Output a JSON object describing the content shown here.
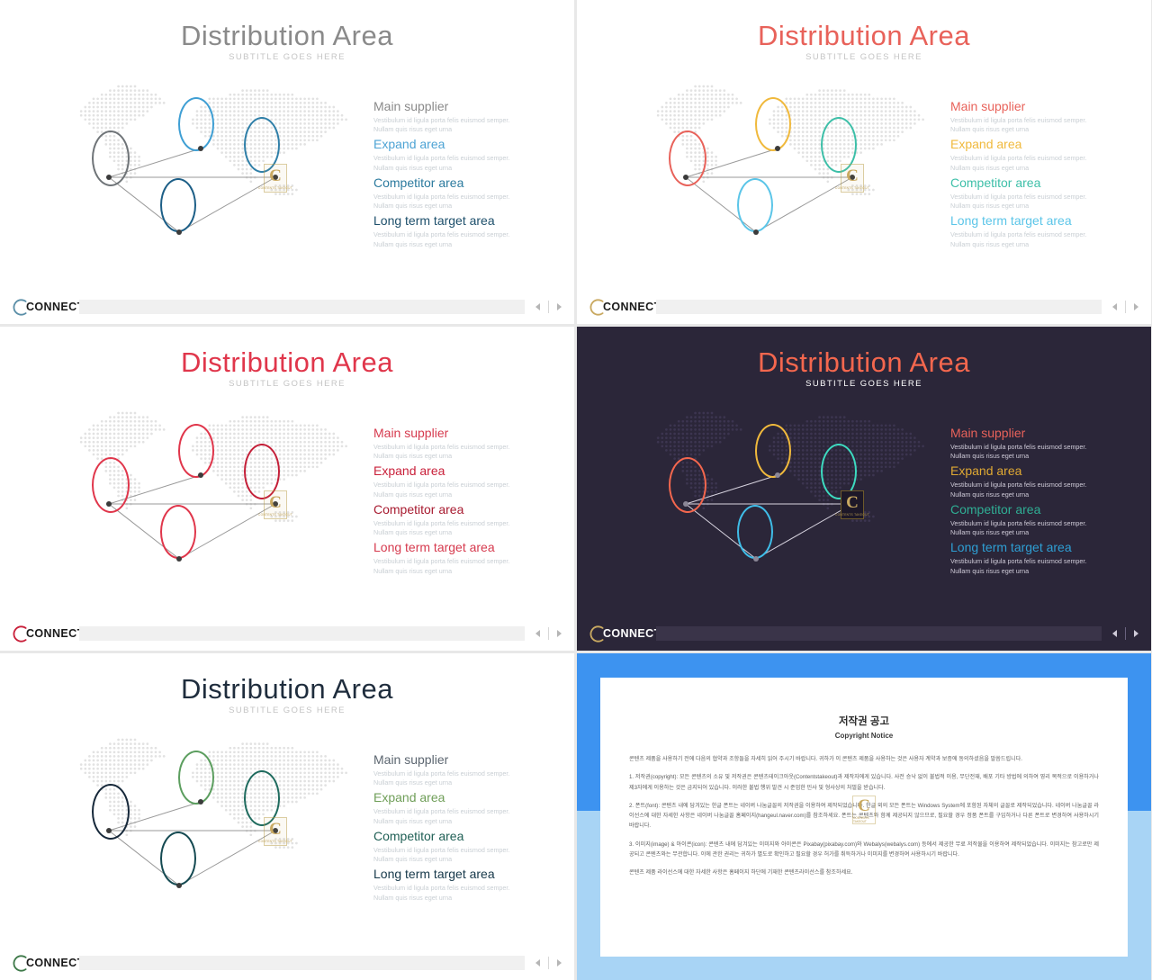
{
  "palettes": {
    "blue": {
      "title": "#8a8a8a",
      "ellipses": [
        "#6f7478",
        "#3f9fd4",
        "#2f7fa8",
        "#1d5f87"
      ],
      "legend": [
        "#8a8a8a",
        "#4da3d4",
        "#2b7a9e",
        "#1d4f6b"
      ]
    },
    "multi": {
      "title": "#e8625a",
      "ellipses": [
        "#e8625a",
        "#f0b93c",
        "#3dbfa8",
        "#5bc5e8"
      ],
      "legend": [
        "#e8625a",
        "#f0b93c",
        "#3dbfa8",
        "#5bc5e8"
      ]
    },
    "red": {
      "title": "#e0364b",
      "ellipses": [
        "#e0364b",
        "#e0364b",
        "#c41f38",
        "#e0364b"
      ],
      "legend": [
        "#d63a4e",
        "#c9203a",
        "#a81b30",
        "#d63a4e"
      ]
    },
    "dark": {
      "title": "#f4674e",
      "ellipses": [
        "#f4674e",
        "#f0b93c",
        "#3ddbc0",
        "#3fbde8"
      ],
      "legend": [
        "#e8625a",
        "#e0a933",
        "#2fae94",
        "#2e9fd4"
      ]
    },
    "green": {
      "title": "#1f2d3d",
      "ellipses": [
        "#16283a",
        "#5c9e5f",
        "#1f6b5e",
        "#154a52"
      ],
      "legend": [
        "#5c6670",
        "#6f9e58",
        "#1f5f55",
        "#16384a"
      ]
    }
  },
  "slides": [
    {
      "name": "distribution-area-blue",
      "title": "Distribution Area",
      "subtitle": "SUBTITLE GOES HERE",
      "palette": "blue",
      "theme": "light"
    },
    {
      "name": "distribution-area-multicolor",
      "title": "Distribution Area",
      "subtitle": "SUBTITLE GOES HERE",
      "palette": "multi",
      "theme": "light"
    },
    {
      "name": "distribution-area-red",
      "title": "Distribution Area",
      "subtitle": "SUBTITLE GOES HERE",
      "palette": "red",
      "theme": "light"
    },
    {
      "name": "distribution-area-dark",
      "title": "Distribution Area",
      "subtitle": "SUBTITLE GOES HERE",
      "palette": "dark",
      "theme": "dark"
    },
    {
      "name": "distribution-area-green",
      "title": "Distribution Area",
      "subtitle": "SUBTITLE GOES HERE",
      "palette": "green",
      "theme": "light"
    }
  ],
  "legend": {
    "items": [
      {
        "heading": "Main supplier",
        "body": "Vestibulum id ligula porta felis euismod semper. Nullam quis risus eget urna"
      },
      {
        "heading": "Expand area",
        "body": "Vestibulum id ligula porta felis euismod semper. Nullam quis risus eget urna"
      },
      {
        "heading": "Competitor area",
        "body": "Vestibulum id ligula porta felis euismod semper. Nullam quis risus eget urna"
      },
      {
        "heading": "Long term target area",
        "body": "Vestibulum id ligula porta felis euismod semper. Nullam quis risus eget urna"
      }
    ]
  },
  "footer": {
    "logo_text": "CONNECT",
    "logo_icon": "c-arc-icon",
    "prev_icon": "triangle-left-icon",
    "next_icon": "triangle-right-icon"
  },
  "badge": {
    "glyph": "C",
    "caption": "CONTENTS TAKEOUT"
  },
  "copyright": {
    "name": "copyright-notice-slide",
    "title_ko": "저작권 공고",
    "title_en": "Copyright Notice",
    "paragraphs": [
      "콘텐츠 제품을 사용하기 전에 다음의 협약과 조항들을 자세히 읽어 주시기 바랍니다. 귀하가 이 콘텐츠 제품을 사용하는 것은 사용자 계약과 보증에 동의하셨음을 말씀드립니다.",
      "1. 저작권(copyright): 모든 콘텐츠의 소유 및 저작권은 콘텐츠테이크아웃(Contentstakeout)과 제작자에게 있습니다. 사전 승낙 없이 불법적 이용, 무단전재, 배포 기타 방법에 의하여 영리 목적으로 이용하거나 제3자에게 이용하는 것은 금지되어 있습니다. 이러한 불법 행위 발견 시 준엄한 민사 및 형사상의 처벌을 받습니다.",
      "2. 폰트(font): 콘텐츠 내에 담겨있는 한글 폰트는 네이버 나눔글꼴의 저작권을 이용하여 제작되었습니다. 한글 외의 모든 폰트는 Windows System에 포함된 자체의 글꼴로 제작되었습니다. 네이버 나눔글꼴 라이선스에 대한 자세한 사항은 네이버 나눔글꼴 홈페이지(hangeul.naver.com)를 참조하세요. 폰트는 콘텐츠와 함께 제공되지 않으므로, 필요할 경우 정품 폰트를 구입하거나 다른 폰트로 변경하여 사용하시기 바랍니다.",
      "3. 이미지(image) & 아이콘(icon): 콘텐츠 내에 담겨있는 이미지와 아이콘은 Pixabay(pixabay.com)와 Webalys(webalys.com) 등에서 제공한 무료 저작물을 이용하여 제작되었습니다. 이미지는 참고로만 제공되고 콘텐츠와는 무관합니다. 이에 관한 권리는 귀하가 별도로 확인하고 필요할 경우 허가를 취득하거나 이미지를 변경하여 사용하시기 바랍니다.",
      "콘텐츠 제품 라이선스에 대한 자세한 사항은 홈페이지 하단에 기재한 콘텐츠라이선스를 참조하세요."
    ]
  }
}
